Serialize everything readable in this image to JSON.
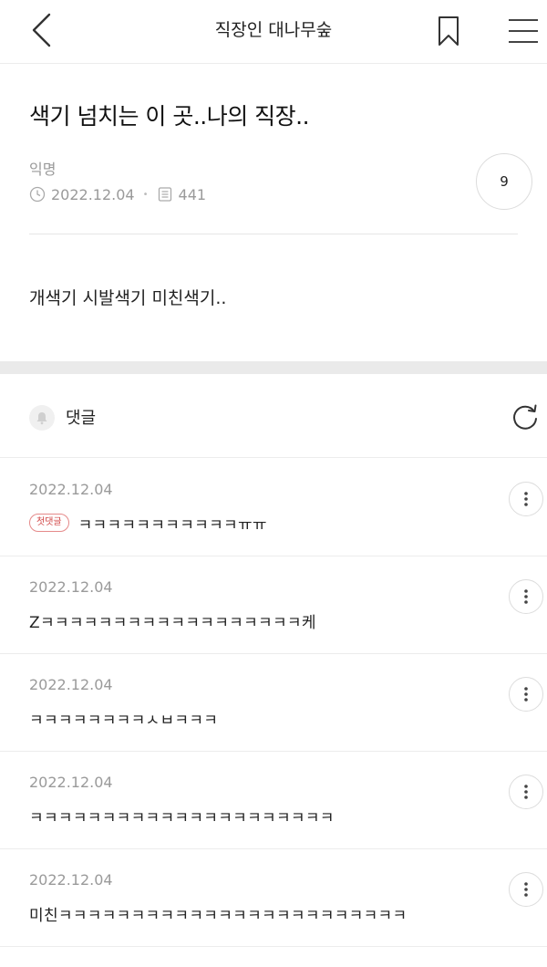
{
  "header": {
    "title": "직장인 대나무숲",
    "back_icon": "chevron-left-icon",
    "bookmark_icon": "bookmark-icon",
    "menu_icon": "hamburger-menu-icon"
  },
  "post": {
    "title": "색기 넘치는 이 곳..나의 직장..",
    "author": "익명",
    "date": "2022.12.04",
    "views": "441",
    "comment_count": "9",
    "body": "개색기 시발색기 미친색기.."
  },
  "comments_section": {
    "label": "댓글",
    "bell_icon": "bell-icon",
    "refresh_icon": "refresh-icon"
  },
  "comments": [
    {
      "date": "2022.12.04",
      "badge": "첫댓글",
      "text": "ㅋㅋㅋㅋㅋㅋㅋㅋㅋㅋㅋㅠㅠ"
    },
    {
      "date": "2022.12.04",
      "text": "Zㅋㅋㅋㅋㅋㅋㅋㅋㅋㅋㅋㅋㅋㅋㅋㅋㅋㅋ케"
    },
    {
      "date": "2022.12.04",
      "text": "ㅋㅋㅋㅋㅋㅋㅋㅋㅅㅂㅋㅋㅋ"
    },
    {
      "date": "2022.12.04",
      "text": "ㅋㅋㅋㅋㅋㅋㅋㅋㅋㅋㅋㅋㅋㅋㅋㅋㅋㅋㅋㅋㅋ"
    },
    {
      "date": "2022.12.04",
      "text": "미친ㅋㅋㅋㅋㅋㅋㅋㅋㅋㅋㅋㅋㅋㅋㅋㅋㅋㅋㅋㅋㅋㅋㅋㅋ"
    }
  ],
  "colors": {
    "badge": "#d04545",
    "meta_text": "#9a9a9a",
    "divider": "#ececec",
    "section_gap": "#eaeaea"
  }
}
